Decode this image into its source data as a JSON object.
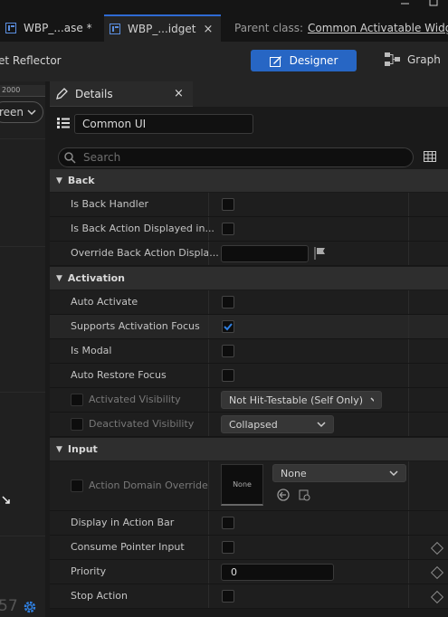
{
  "tabs": [
    {
      "label": "WBP_...ase *",
      "active": false
    },
    {
      "label": "WBP_...idget",
      "active": true,
      "close": "×"
    }
  ],
  "parent_class": {
    "label": "Parent class:",
    "value": "Common Activatable Widge"
  },
  "toolbar": {
    "reflector_label": "et Reflector",
    "designer_label": "Designer",
    "graph_label": "Graph"
  },
  "left_panel": {
    "ruler_value": "2000",
    "screen_dropdown": "reen",
    "zoom_fragment": "57"
  },
  "details": {
    "tab_label": "Details",
    "close": "×",
    "object_name": "Common UI",
    "search_placeholder": "Search",
    "categories": {
      "back": "Back",
      "activation": "Activation",
      "input": "Input"
    },
    "rows": {
      "is_back_handler": "Is Back Handler",
      "is_back_action_displayed": "Is Back Action Displayed in...",
      "override_back_action": "Override Back Action Displa...",
      "auto_activate": "Auto Activate",
      "supports_activation_focus": "Supports Activation Focus",
      "is_modal": "Is Modal",
      "auto_restore_focus": "Auto Restore Focus",
      "activated_visibility": "Activated Visibility",
      "deactivated_visibility": "Deactivated Visibility",
      "action_domain_override": "Action Domain Override",
      "display_in_action_bar": "Display in Action Bar",
      "consume_pointer_input": "Consume Pointer Input",
      "priority": "Priority",
      "stop_action": "Stop Action"
    },
    "values": {
      "supports_activation_focus_checked": true,
      "activated_visibility": "Not Hit-Testable (Self Only)",
      "deactivated_visibility": "Collapsed",
      "none_swatch": "None",
      "none_combo": "None",
      "priority": "0"
    }
  },
  "colors": {
    "accent": "#2766c4",
    "check": "#2f7fe0"
  }
}
